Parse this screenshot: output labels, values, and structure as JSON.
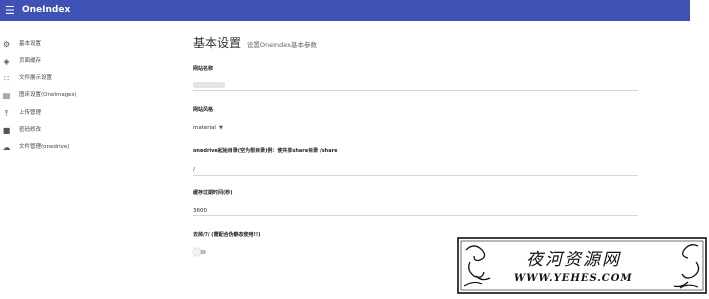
{
  "app": {
    "title": "OneIndex",
    "accent": "#3f51b5"
  },
  "sidebar": {
    "items": [
      {
        "label": "基本设置",
        "icon": "gear-icon"
      },
      {
        "label": "页面缓存",
        "icon": "layers-icon"
      },
      {
        "label": "文件展示设置",
        "icon": "grid-icon"
      },
      {
        "label": "图床设置(OneImages)",
        "icon": "image-icon"
      },
      {
        "label": "上传管理",
        "icon": "upload-icon"
      },
      {
        "label": "密码修改",
        "icon": "lock-icon"
      },
      {
        "label": "文件管理(onedrive)",
        "icon": "cloud-icon"
      }
    ]
  },
  "main": {
    "title": "基本设置",
    "subtitle": "设置OneIndex基本参数",
    "fields": [
      {
        "label": "网站名称"
      },
      {
        "label": "网站风格",
        "value": "material"
      },
      {
        "label": "onedrive起始目录(空为根目录)例：使共享share目录 /share",
        "value": "/"
      },
      {
        "label": "缓存过期时间(秒)",
        "value": "3600"
      },
      {
        "label": "去掉/?/ (需配合伪静态使用!!)"
      }
    ]
  },
  "watermark": {
    "text": "夜河资源网",
    "url": "WWW.YEHES.COM"
  }
}
